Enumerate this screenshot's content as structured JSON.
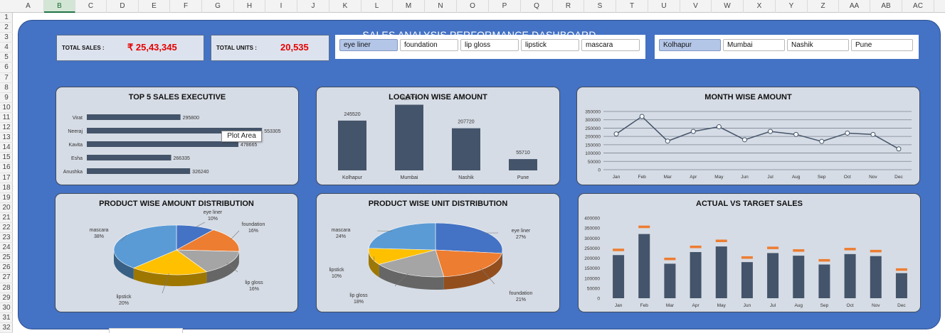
{
  "sheet": {
    "columns": [
      "A",
      "B",
      "C",
      "D",
      "E",
      "F",
      "G",
      "H",
      "I",
      "J",
      "K",
      "L",
      "M",
      "N",
      "O",
      "P",
      "Q",
      "R",
      "S",
      "T",
      "U",
      "V",
      "W",
      "X",
      "Y",
      "Z",
      "AA",
      "AB",
      "AC"
    ],
    "selected_column": "B",
    "rows": [
      "1",
      "2",
      "3",
      "4",
      "5",
      "6",
      "7",
      "8",
      "9",
      "10",
      "11",
      "12",
      "13",
      "14",
      "15",
      "16",
      "17",
      "18",
      "19",
      "20",
      "21",
      "22",
      "23",
      "24",
      "25",
      "26",
      "27",
      "28",
      "29",
      "30",
      "31",
      "32"
    ]
  },
  "dashboard": {
    "title": "SALES ANALYSIS PERFORMANCE DASHBOARD",
    "total_sales_label": "TOTAL SALES :",
    "total_sales_value": "₹ 25,43,345",
    "total_units_label": "TOTAL UNITS :",
    "total_units_value": "20,535",
    "colors": {
      "background": "#4472c4",
      "panel": "#d6dce5",
      "bar": "#44546a",
      "kpi_value": "#e50000",
      "target": "#ed7d31"
    }
  },
  "product_slicer": {
    "items": [
      {
        "label": "eye liner",
        "selected": true
      },
      {
        "label": "foundation",
        "selected": false
      },
      {
        "label": "lip gloss",
        "selected": false
      },
      {
        "label": "lipstick",
        "selected": false
      },
      {
        "label": "mascara",
        "selected": false
      }
    ]
  },
  "location_slicer": {
    "items": [
      {
        "label": "Kolhapur",
        "selected": true
      },
      {
        "label": "Mumbai",
        "selected": false
      },
      {
        "label": "Nashik",
        "selected": false
      },
      {
        "label": "Pune",
        "selected": false
      }
    ]
  },
  "tooltip": {
    "text": "Plot Area"
  },
  "chart_data": [
    {
      "id": "top5",
      "type": "bar",
      "orientation": "horizontal",
      "title": "TOP 5 SALES EXECUTIVE",
      "categories": [
        "Virat",
        "Neeraj",
        "Kavita",
        "Esha",
        "Anushka"
      ],
      "values": [
        295800,
        553305,
        478665,
        266335,
        326240
      ],
      "value_labels": [
        "295800",
        "553305",
        "478665",
        "266335",
        "326240"
      ],
      "xlim": [
        0,
        600000
      ],
      "grid": false
    },
    {
      "id": "location",
      "type": "bar",
      "title": "LOCATION WISE AMOUNT",
      "categories": [
        "Kolhapur",
        "Mumbai",
        "Nashik",
        "Pune"
      ],
      "values": [
        245520,
        323775,
        207720,
        55710
      ],
      "value_labels": [
        "245520",
        "323775",
        "207720",
        "55710"
      ],
      "ylim": [
        0,
        350000
      ],
      "grid": false
    },
    {
      "id": "month",
      "type": "line",
      "title": "MONTH WISE AMOUNT",
      "categories": [
        "Jan",
        "Feb",
        "Mar",
        "Apr",
        "May",
        "Jun",
        "Jul",
        "Aug",
        "Sep",
        "Oct",
        "Nov",
        "Dec"
      ],
      "values": [
        215000,
        320000,
        172000,
        230000,
        258000,
        180000,
        230000,
        212000,
        170000,
        220000,
        212000,
        125000
      ],
      "yticks": [
        "0",
        "50000",
        "100000",
        "150000",
        "200000",
        "250000",
        "300000",
        "350000"
      ],
      "ylim": [
        0,
        350000
      ],
      "grid": true
    },
    {
      "id": "product_amount",
      "type": "pie",
      "title": "PRODUCT WISE AMOUNT DISTRIBUTION",
      "slices": [
        {
          "name": "eye liner",
          "label": "10%",
          "value": 10,
          "color": "#4472c4"
        },
        {
          "name": "foundation",
          "label": "16%",
          "value": 16,
          "color": "#ed7d31"
        },
        {
          "name": "lip gloss",
          "label": "16%",
          "value": 16,
          "color": "#a5a5a5"
        },
        {
          "name": "lipstick",
          "label": "20%",
          "value": 20,
          "color": "#ffc000"
        },
        {
          "name": "mascara",
          "label": "38%",
          "value": 38,
          "color": "#5b9bd5"
        }
      ]
    },
    {
      "id": "product_unit",
      "type": "pie",
      "title": "PRODUCT WISE UNIT DISTRIBUTION",
      "slices": [
        {
          "name": "eye liner",
          "label": "27%",
          "value": 27,
          "color": "#4472c4"
        },
        {
          "name": "foundation",
          "label": "21%",
          "value": 21,
          "color": "#ed7d31"
        },
        {
          "name": "lip gloss",
          "label": "18%",
          "value": 18,
          "color": "#a5a5a5"
        },
        {
          "name": "lipstick",
          "label": "10%",
          "value": 10,
          "color": "#ffc000"
        },
        {
          "name": "mascara",
          "label": "24%",
          "value": 24,
          "color": "#5b9bd5"
        }
      ]
    },
    {
      "id": "actual_target",
      "type": "bar",
      "title": "ACTUAL VS TARGET SALES",
      "categories": [
        "Jan",
        "Feb",
        "Mar",
        "Apr",
        "May",
        "Jun",
        "Jul",
        "Aug",
        "Sep",
        "Oct",
        "Nov",
        "Dec"
      ],
      "series": [
        {
          "values": [
            215000,
            320000,
            172000,
            230000,
            258000,
            180000,
            225000,
            212000,
            168000,
            220000,
            210000,
            125000
          ]
        },
        {
          "values": [
            240000,
            355000,
            195000,
            255000,
            285000,
            202000,
            250000,
            237000,
            188000,
            244000,
            234000,
            142000
          ]
        }
      ],
      "yticks": [
        "0",
        "50000",
        "100000",
        "150000",
        "200000",
        "250000",
        "300000",
        "350000",
        "400000"
      ],
      "ylim": [
        0,
        400000
      ],
      "grid": false
    }
  ]
}
